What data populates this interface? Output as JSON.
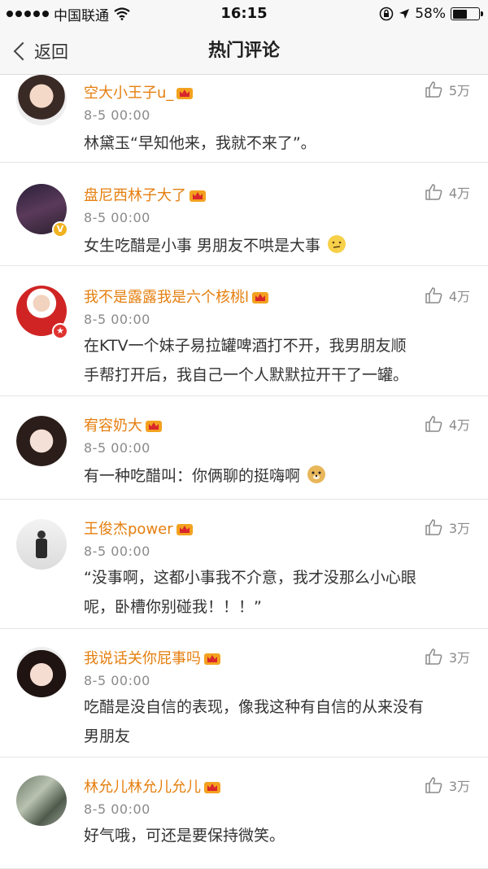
{
  "status_bar": {
    "carrier": "中国联通",
    "time": "16:15",
    "battery_pct": "58%",
    "battery_level": 0.58
  },
  "nav": {
    "back_label": "返回",
    "title": "热门评论"
  },
  "comments": [
    {
      "user": "空大小王子u_",
      "time": "8-5 00:00",
      "text": "林黛玉“早知他来，我就不来了”。",
      "likes": "5万"
    },
    {
      "user": "盘尼西林子大了",
      "time": "8-5 00:00",
      "text": "女生吃醋是小事  男朋友不哄是大事",
      "likes": "4万"
    },
    {
      "user": "我不是露露我是六个核桃l",
      "time": "8-5 00:00",
      "text_lines": [
        "在KTV一个妹子易拉罐啤酒打不开，我男朋友顺",
        "手帮打开后，我自己一个人默默拉开干了一罐。"
      ],
      "likes": "4万"
    },
    {
      "user": "宥容奶大",
      "time": "8-5 00:00",
      "text": "有一种吃醋叫：你俩聊的挺嗨啊",
      "likes": "4万"
    },
    {
      "user": "王俊杰power",
      "time": "8-5 00:00",
      "text_lines": [
        "“没事啊，这都小事我不介意，我才没那么小心眼",
        "呢，卧槽你别碰我！！！”"
      ],
      "likes": "3万"
    },
    {
      "user": "我说话关你屁事吗",
      "time": "8-5 00:00",
      "text_lines": [
        "吃醋是没自信的表现，像我这种有自信的从来没有",
        "男朋友"
      ],
      "likes": "3万"
    },
    {
      "user": "林允儿林允儿允儿",
      "time": "8-5 00:00",
      "text": "好气哦，可还是要保持微笑。",
      "likes": "3万"
    }
  ],
  "colors": {
    "username": "#e57f0f",
    "time": "#8a8a8a",
    "text": "#333333",
    "background": "#f2f2f2"
  }
}
